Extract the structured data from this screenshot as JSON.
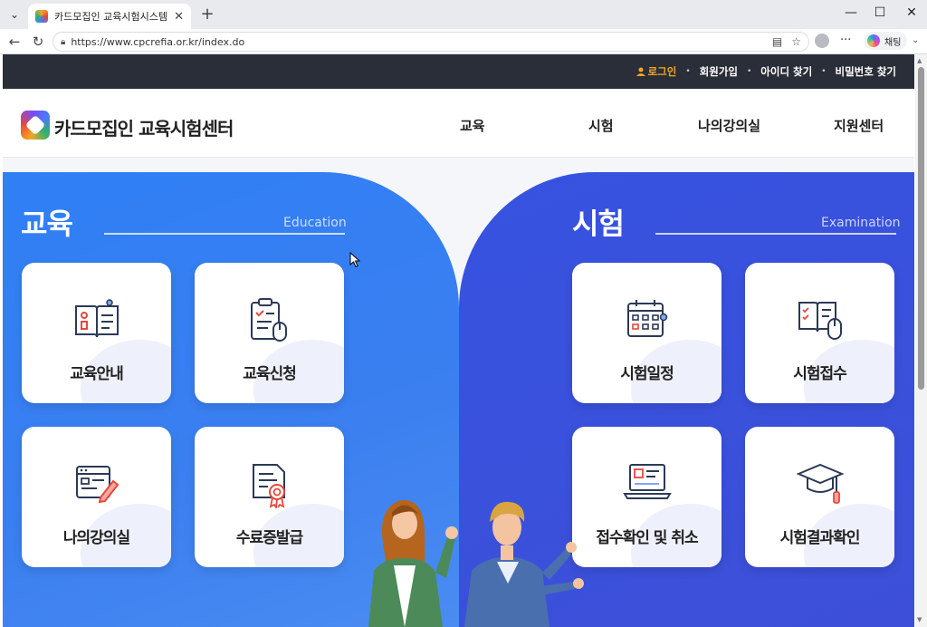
{
  "browser": {
    "tab_title": "카드모집인 교육시험시스템",
    "url": "https://www.cpcrefia.or.kr/index.do",
    "copilot_label": "채팅"
  },
  "utility": {
    "login": "로그인",
    "signup": "회원가입",
    "find_id": "아이디 찾기",
    "find_pw": "비밀번호 찾기"
  },
  "gnb": {
    "logo_text": "카드모집인 교육시험센터",
    "menu": [
      "교육",
      "시험",
      "나의강의실",
      "지원센터"
    ]
  },
  "education": {
    "title": "교육",
    "subtitle": "Education",
    "cards": [
      "교육안내",
      "교육신청",
      "나의강의실",
      "수료증발급"
    ]
  },
  "exam": {
    "title": "시험",
    "subtitle": "Examination",
    "cards": [
      "시험일정",
      "시험접수",
      "접수확인 및 취소",
      "시험결과확인"
    ]
  },
  "colors": {
    "edu_panel": "#2f7ff5",
    "exam_panel": "#3653e0",
    "util_bar": "#2a2e38",
    "login_accent": "#f5a623"
  }
}
